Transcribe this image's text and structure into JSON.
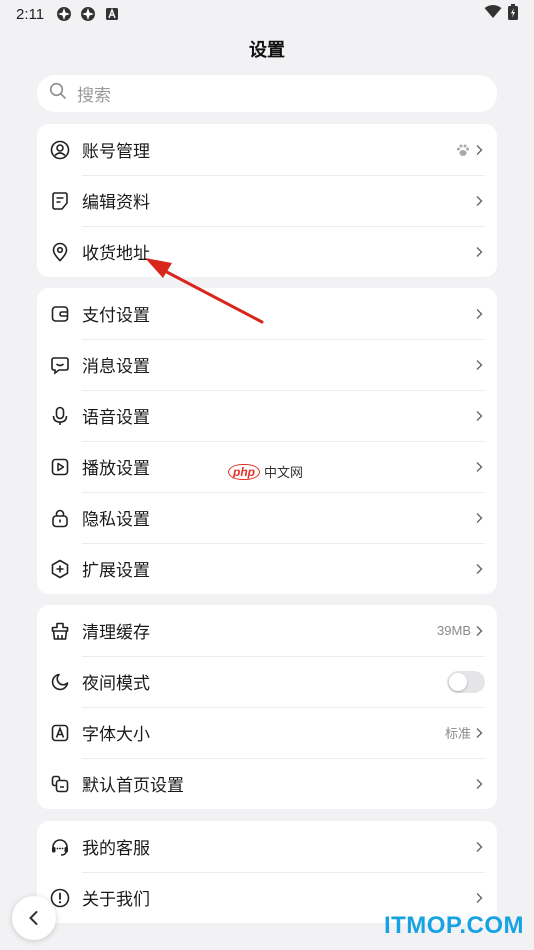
{
  "status_bar": {
    "time": "2:11",
    "icons": [
      "app-icon",
      "app-icon",
      "a-icon"
    ],
    "right_icons": [
      "wifi-icon",
      "battery-charging-icon"
    ]
  },
  "page": {
    "title": "设置"
  },
  "search": {
    "placeholder": "搜索"
  },
  "sections": [
    {
      "items": [
        {
          "label": "账号管理",
          "icon": "user-circle-icon",
          "extra_icon": "paw-icon"
        },
        {
          "label": "编辑资料",
          "icon": "edit-note-icon"
        },
        {
          "label": "收货地址",
          "icon": "location-pin-icon"
        }
      ]
    },
    {
      "items": [
        {
          "label": "支付设置",
          "icon": "wallet-icon"
        },
        {
          "label": "消息设置",
          "icon": "message-icon"
        },
        {
          "label": "语音设置",
          "icon": "microphone-icon"
        },
        {
          "label": "播放设置",
          "icon": "play-icon"
        },
        {
          "label": "隐私设置",
          "icon": "lock-icon"
        },
        {
          "label": "扩展设置",
          "icon": "plus-hexagon-icon"
        }
      ]
    },
    {
      "items": [
        {
          "label": "清理缓存",
          "icon": "broom-icon",
          "value": "39MB"
        },
        {
          "label": "夜间模式",
          "icon": "moon-icon",
          "toggle": false
        },
        {
          "label": "字体大小",
          "icon": "font-size-icon",
          "value": "标准"
        },
        {
          "label": "默认首页设置",
          "icon": "home-layout-icon"
        }
      ]
    },
    {
      "items": [
        {
          "label": "我的客服",
          "icon": "headset-icon"
        },
        {
          "label": "关于我们",
          "icon": "info-icon"
        }
      ]
    }
  ],
  "watermarks": {
    "php_badge": "php",
    "php_text": "中文网",
    "site": "ITMOP.COM"
  },
  "annotation": {
    "arrow_color": "#d9261c"
  },
  "colors": {
    "background": "#f2f2f4",
    "card": "#ffffff",
    "site_watermark": "#17a3e3"
  }
}
